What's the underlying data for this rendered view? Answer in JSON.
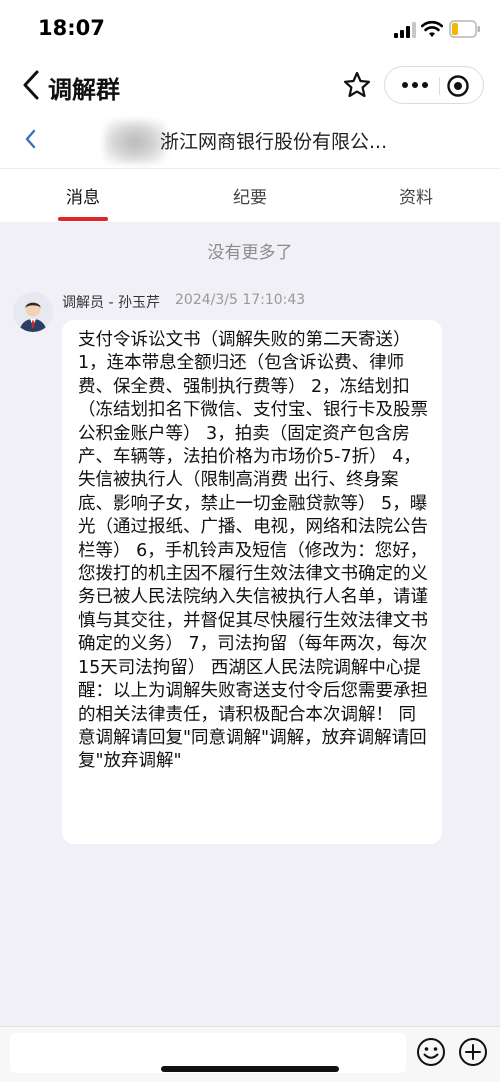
{
  "status_bar": {
    "time": "18:07"
  },
  "header": {
    "title": "调解群",
    "icons": [
      "back-arrow-icon",
      "star-icon",
      "more-icon",
      "close-target-icon"
    ]
  },
  "subheader": {
    "title": "浙江网商银行股份有限公..."
  },
  "tabs": [
    {
      "label": "消息",
      "active": true
    },
    {
      "label": "纪要",
      "active": false
    },
    {
      "label": "资料",
      "active": false
    }
  ],
  "chat": {
    "no_more_text": "没有更多了",
    "messages": [
      {
        "sender": "调解员 - 孙玉芹",
        "timestamp": "2024/3/5 17:10:43",
        "text": "支付令诉讼文书（调解失败的第二天寄送） 1，连本带息全额归还（包含诉讼费、律师费、保全费、强制执行费等） 2，冻结划扣（冻结划扣名下微信、支付宝、银行卡及股票公积金账户等） 3，拍卖（固定资产包含房产、车辆等，法拍价格为市场价5-7折） 4，失信被执行人（限制高消费 出行、终身案底、影响子女，禁止一切金融贷款等） 5，曝光（通过报纸、广播、电视，网络和法院公告栏等） 6，手机铃声及短信（修改为：您好，您拨打的机主因不履行生效法律文书确定的义务已被人民法院纳入失信被执行人名单，请谨慎与其交往，并督促其尽快履行生效法律文书确定的义务） 7，司法拘留（每年两次，每次15天司法拘留） 西湖区人民法院调解中心提醒：以上为调解失败寄送支付令后您需要承担的相关法律责任，请积极配合本次调解！ 同意调解请回复\"同意调解\"调解，放弃调解请回复\"放弃调解\""
      }
    ]
  },
  "input": {
    "value": "",
    "placeholder": ""
  },
  "colors": {
    "accent": "#e0252b",
    "background": "#f0f0f6",
    "bubble": "#ffffff",
    "link_blue": "#3a6fc4"
  }
}
